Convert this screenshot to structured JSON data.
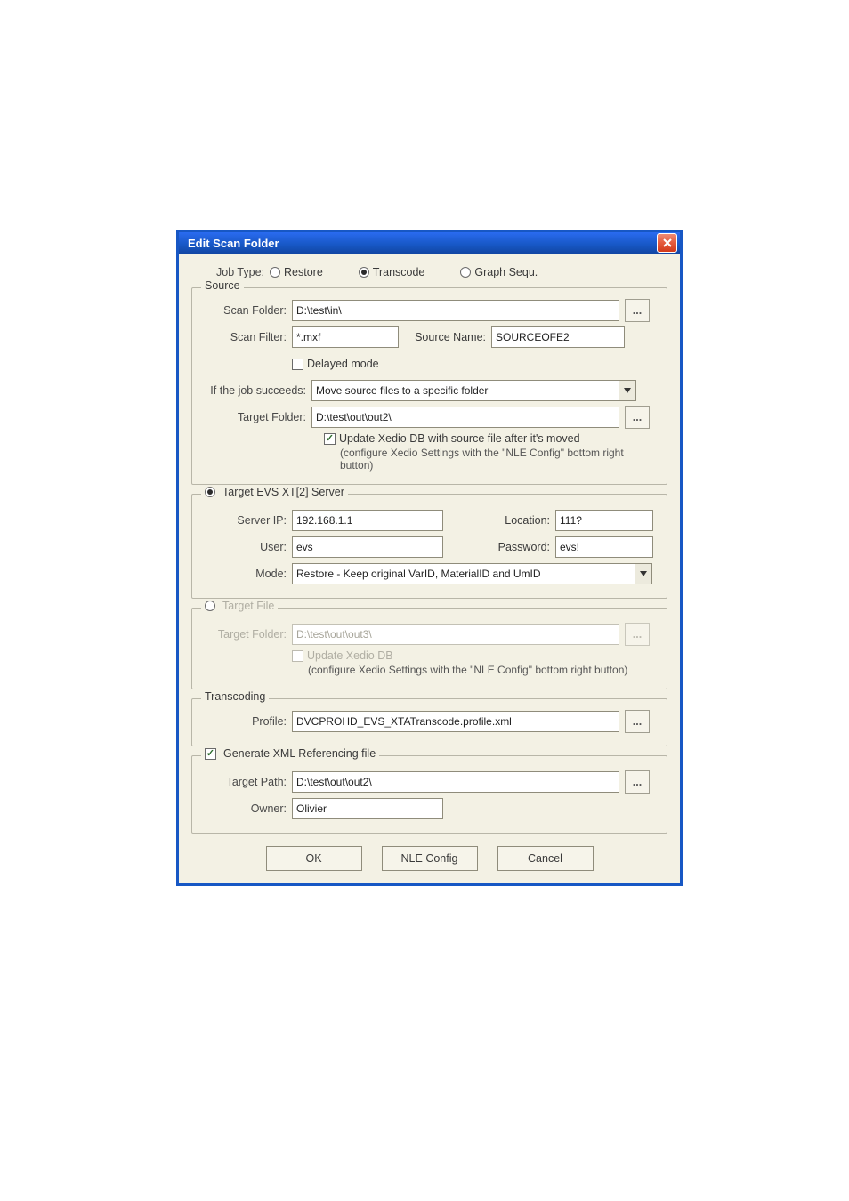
{
  "dialog": {
    "title": "Edit Scan Folder"
  },
  "jobtype": {
    "label": "Job Type:",
    "options": {
      "restore": "Restore",
      "transcode": "Transcode",
      "graph": "Graph Sequ."
    }
  },
  "source": {
    "legend": "Source",
    "scan_folder_label": "Scan Folder:",
    "scan_folder_value": "D:\\test\\in\\",
    "scan_filter_label": "Scan Filter:",
    "scan_filter_value": "*.mxf",
    "source_name_label": "Source Name:",
    "source_name_value": "SOURCEOFE2",
    "delayed_mode_label": "Delayed mode",
    "succeeds_label": "If the job succeeds:",
    "succeeds_value": "Move source files to a specific folder",
    "target_folder_label": "Target Folder:",
    "target_folder_value": "D:\\test\\out\\out2\\",
    "update_db_label": "Update Xedio DB with source file after it's moved",
    "update_db_hint": "(configure Xedio Settings with the \"NLE Config\" bottom right button)"
  },
  "target_server": {
    "legend": "Target EVS XT[2] Server",
    "server_ip_label": "Server IP:",
    "server_ip_value": "192.168.1.1",
    "location_label": "Location:",
    "location_value": "111?",
    "user_label": "User:",
    "user_value": "evs",
    "password_label": "Password:",
    "password_value": "evs!",
    "mode_label": "Mode:",
    "mode_value": "Restore - Keep original VarID, MaterialID and UmID"
  },
  "target_file": {
    "legend": "Target File",
    "target_folder_label": "Target Folder:",
    "target_folder_value": "D:\\test\\out\\out3\\",
    "update_db_label": "Update Xedio DB",
    "update_db_hint": "(configure Xedio Settings with the \"NLE Config\" bottom right button)"
  },
  "transcoding": {
    "legend": "Transcoding",
    "profile_label": "Profile:",
    "profile_value": "DVCPROHD_EVS_XTATranscode.profile.xml"
  },
  "xmlref": {
    "checkbox_label": "Generate XML Referencing file",
    "target_path_label": "Target Path:",
    "target_path_value": "D:\\test\\out\\out2\\",
    "owner_label": "Owner:",
    "owner_value": "Olivier"
  },
  "buttons": {
    "ok": "OK",
    "nle": "NLE Config",
    "cancel": "Cancel"
  },
  "browse_label": "..."
}
